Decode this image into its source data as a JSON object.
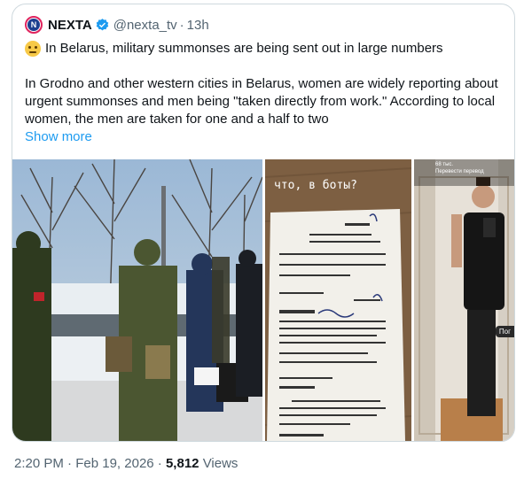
{
  "tweet": {
    "author_name": "NEXTA",
    "handle": "@nexta_tv",
    "separator": "·",
    "time_ago": "13h",
    "headline": "In Belarus, military summonses are being sent out  in large numbers",
    "body": "In Grodno and other western cities in Belarus, women are widely reporting about urgent summonses and men being \"taken directly from work.\" According to local women, the men are taken for one and a half to two",
    "show_more": "Show more",
    "icons": {
      "avatar": "nexta-logo-icon",
      "verified": "verified-badge-icon",
      "emoji": "thinking-face-emoji"
    }
  },
  "media": {
    "document_caption": "что, в боты?",
    "instagram_handle": "68 тыс.",
    "instagram_sub": "Перевести перевод",
    "instagram_tag": "Пог"
  },
  "footer": {
    "time": "2:20 PM",
    "sep1": "·",
    "date": "Feb 19, 2026",
    "sep2": "·",
    "views_count": "5,812",
    "views_label": "Views"
  },
  "colors": {
    "link": "#1d9bf0",
    "muted": "#536471",
    "text": "#0f1419",
    "verified": "#1d9bf0"
  }
}
